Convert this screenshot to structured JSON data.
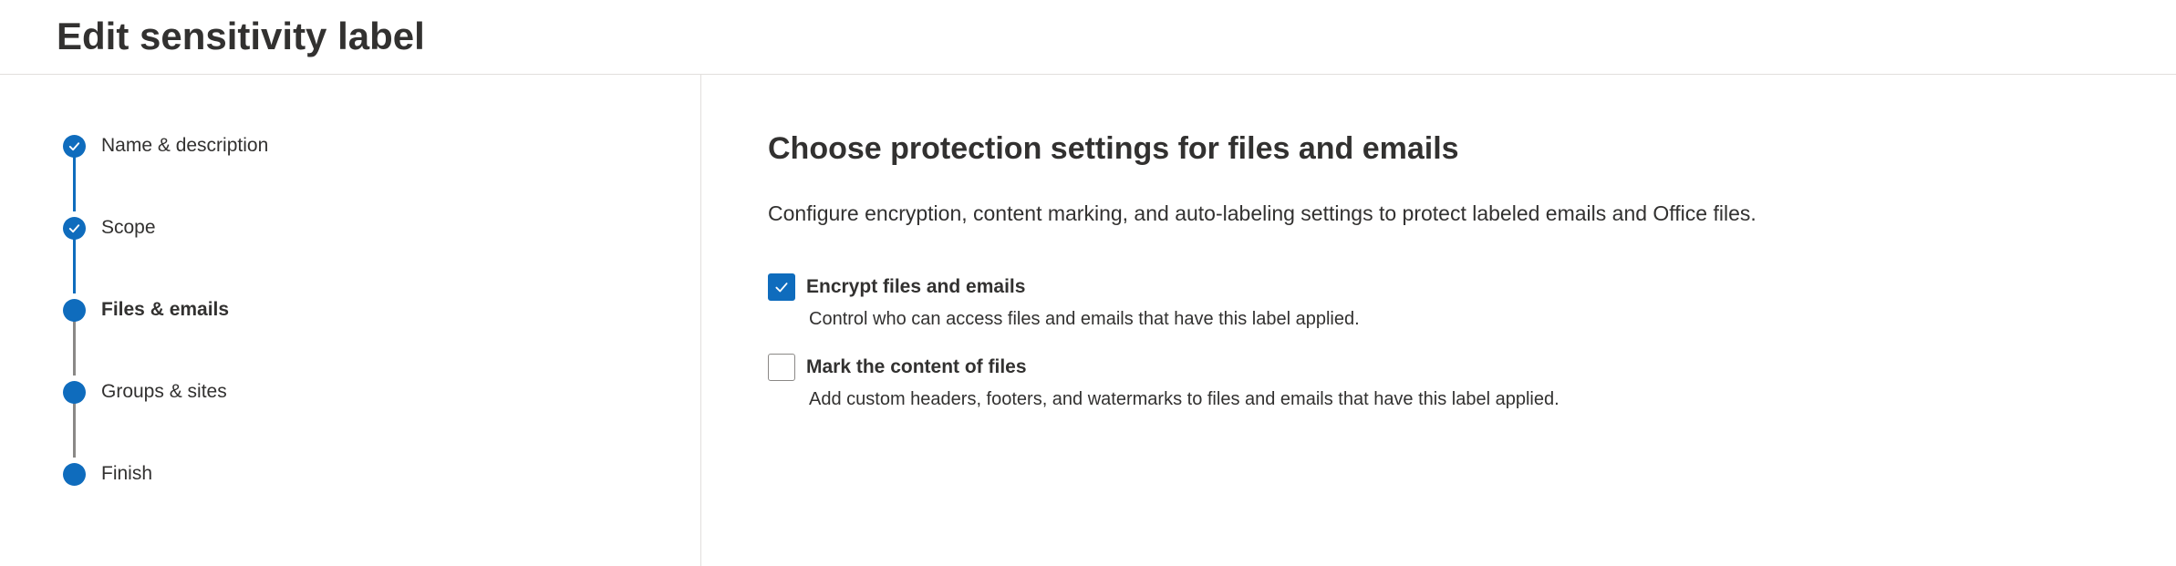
{
  "header": {
    "title": "Edit sensitivity label"
  },
  "wizard": {
    "steps": [
      {
        "label": "Name & description",
        "status": "completed",
        "icon": "checkmark-icon"
      },
      {
        "label": "Scope",
        "status": "completed",
        "icon": "checkmark-icon"
      },
      {
        "label": "Files & emails",
        "status": "current",
        "icon": "filled-dot-icon"
      },
      {
        "label": "Groups & sites",
        "status": "upcoming",
        "icon": "filled-dot-icon"
      },
      {
        "label": "Finish",
        "status": "upcoming",
        "icon": "filled-dot-icon"
      }
    ]
  },
  "main": {
    "title": "Choose protection settings for files and emails",
    "description": "Configure encryption, content marking, and auto-labeling settings to protect labeled emails and Office files.",
    "options": [
      {
        "label": "Encrypt files and emails",
        "description": "Control who can access files and emails that have this label applied.",
        "checked": true
      },
      {
        "label": "Mark the content of files",
        "description": "Add custom headers, footers, and watermarks to files and emails that have this label applied.",
        "checked": false
      }
    ]
  },
  "colors": {
    "accent": "#0f6cbd",
    "text": "#323130",
    "divider": "#e1dfdd",
    "pending_connector": "#8a8886"
  }
}
